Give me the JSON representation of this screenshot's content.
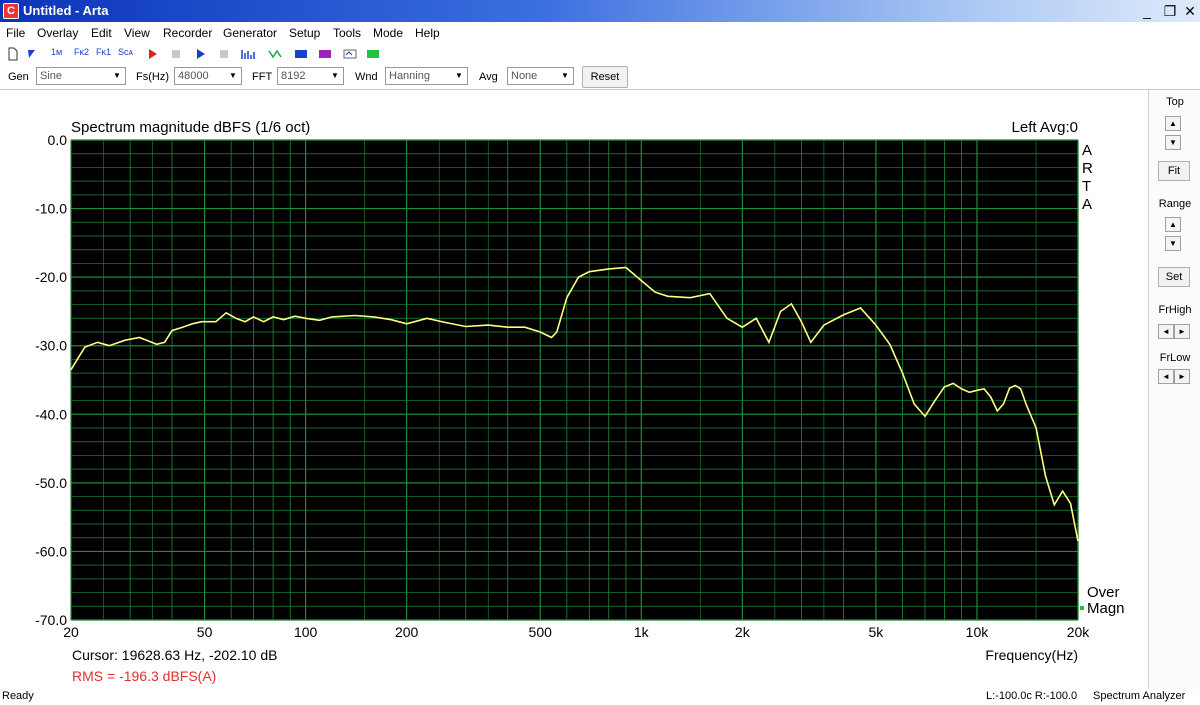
{
  "window": {
    "title": "Untitled - Arta",
    "min": "_",
    "restore": "❐",
    "close": "✕"
  },
  "menu": [
    "File",
    "Overlay",
    "Edit",
    "View",
    "Recorder",
    "Generator",
    "Setup",
    "Tools",
    "Mode",
    "Help"
  ],
  "toolbar_icons": [
    "new-file-icon",
    "open-icon",
    "f1-marker-icon",
    "f2-marker-icon",
    "fft-icon",
    "scan-icon",
    "record-icon",
    "stop-icon",
    "play-icon",
    "pause-icon",
    "spectrum-icon",
    "impulse-icon",
    "color-icon",
    "overlay-icon",
    "export-icon",
    "measure-icon"
  ],
  "toolbar_labels": {
    "f1": "1ᴍ",
    "f2": "Fᴋ2",
    "f3": "Fᴋ1",
    "scan": "Sᴄᴀ"
  },
  "params": {
    "gen_label": "Gen",
    "gen_value": "Sine",
    "fs_label": "Fs(Hz)",
    "fs_value": "48000",
    "fft_label": "FFT",
    "fft_value": "8192",
    "wnd_label": "Wnd",
    "wnd_value": "Hanning",
    "avg_label": "Avg",
    "avg_value": "None",
    "reset": "Reset"
  },
  "side": {
    "top_label": "Top",
    "fit": "Fit",
    "range_label": "Range",
    "set": "Set",
    "frhigh_label": "FrHigh",
    "frlow_label": "FrLow",
    "up": "▲",
    "down": "▼",
    "left": "◄",
    "right": "►"
  },
  "plot": {
    "channel_info": "Left  Avg:0",
    "arta_vertical": [
      "A",
      "R",
      "T",
      "A"
    ],
    "over_label": "Over",
    "magn_label": "Magn",
    "cursor": "Cursor: 19628.63 Hz, -202.10 dB",
    "rms": "RMS = -196.3 dBFS(A)"
  },
  "status": {
    "left": "Ready",
    "levels": "L:-100.0c  R:-100.0",
    "mode": "Spectrum Analyzer"
  },
  "chart_data": {
    "type": "line",
    "title": "Spectrum magnitude dBFS (1/6 oct)",
    "xlabel": "Frequency(Hz)",
    "ylabel": "",
    "xscale": "log",
    "xlim": [
      20,
      20000
    ],
    "ylim": [
      -70,
      0
    ],
    "xticks": [
      20,
      50,
      100,
      200,
      500,
      1000,
      2000,
      5000,
      10000,
      20000
    ],
    "xtick_labels": [
      "20",
      "50",
      "100",
      "200",
      "500",
      "1k",
      "2k",
      "5k",
      "10k",
      "20k"
    ],
    "yticks": [
      0,
      -10,
      -20,
      -30,
      -40,
      -50,
      -60,
      -70
    ],
    "ytick_labels": [
      "0.0",
      "-10.0",
      "-20.0",
      "-30.0",
      "-40.0",
      "-50.0",
      "-60.0",
      "-70.0"
    ],
    "grid": true,
    "colors": {
      "background": "#000000",
      "grid": "#1f8a3a",
      "trace": "#ffff80",
      "rms": "#e03030"
    },
    "series": [
      {
        "x": [
          20,
          21,
          22,
          24,
          26,
          29,
          32,
          36,
          38,
          40,
          43,
          46,
          49,
          54,
          58,
          62,
          66,
          70,
          75,
          80,
          86,
          93,
          100,
          110,
          120,
          140,
          160,
          180,
          200,
          230,
          260,
          300,
          350,
          400,
          450,
          500,
          540,
          560,
          600,
          650,
          700,
          800,
          900,
          1000,
          1100,
          1200,
          1400,
          1600,
          1800,
          2000,
          2200,
          2400,
          2600,
          2800,
          3000,
          3200,
          3500,
          4000,
          4500,
          5000,
          5500,
          6000,
          6500,
          7000,
          7500,
          8000,
          8500,
          9000,
          9500,
          10000,
          10500,
          11000,
          11500,
          12000,
          12500,
          13000,
          13500,
          14000,
          15000,
          16000,
          17000,
          18000,
          19000,
          20000
        ],
        "values": [
          -33.5,
          -31.8,
          -30.2,
          -29.5,
          -30.0,
          -29.2,
          -28.8,
          -29.8,
          -29.5,
          -27.8,
          -27.3,
          -26.8,
          -26.5,
          -26.5,
          -25.2,
          -26.0,
          -26.5,
          -25.8,
          -26.5,
          -25.8,
          -26.2,
          -25.7,
          -26.0,
          -26.3,
          -25.8,
          -25.6,
          -25.8,
          -26.2,
          -26.8,
          -26.0,
          -26.6,
          -27.2,
          -27.0,
          -27.3,
          -27.3,
          -28.0,
          -28.8,
          -28.0,
          -23.0,
          -20.0,
          -19.2,
          -18.8,
          -18.6,
          -20.5,
          -22.2,
          -22.8,
          -23.0,
          -22.4,
          -26.0,
          -27.3,
          -26.0,
          -29.5,
          -25.0,
          -23.9,
          -26.5,
          -29.5,
          -27.0,
          -25.5,
          -24.5,
          -27.0,
          -29.8,
          -34.0,
          -38.5,
          -40.3,
          -38.0,
          -36.0,
          -35.5,
          -36.3,
          -36.8,
          -36.5,
          -36.3,
          -37.5,
          -39.5,
          -38.5,
          -36.2,
          -35.8,
          -36.3,
          -38.5,
          -42.0,
          -49.0,
          -53.2,
          -51.2,
          -53.0,
          -58.5
        ]
      }
    ]
  }
}
